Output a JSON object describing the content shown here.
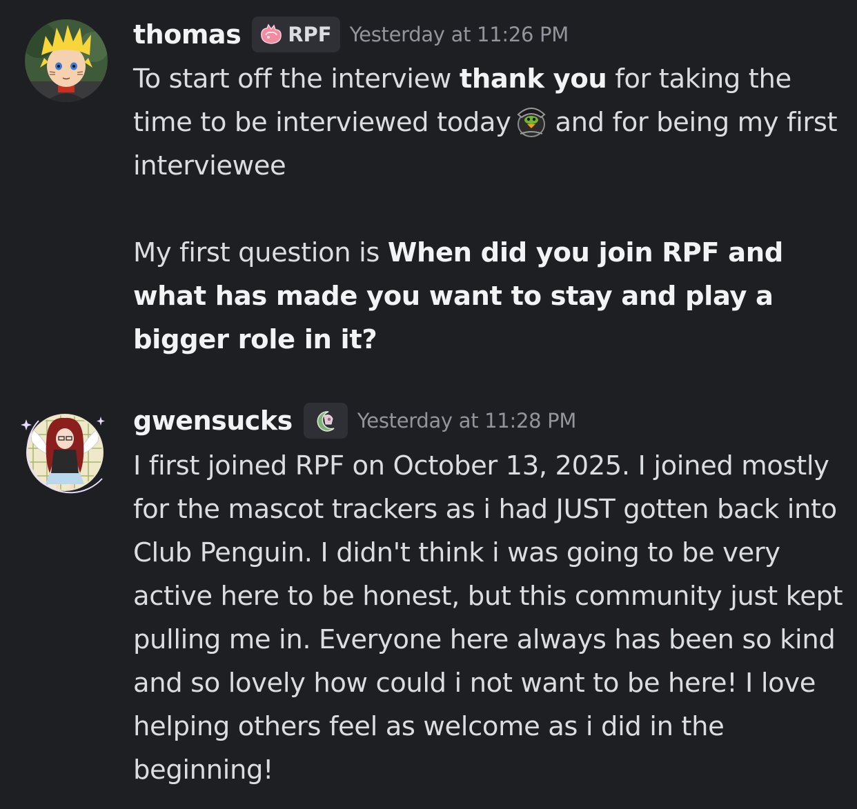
{
  "messages": [
    {
      "author": "thomas",
      "tag": "RPF",
      "timestamp": "Yesterday at 11:26 PM",
      "p1": {
        "t1": "To start off the interview ",
        "b1": "thank you",
        "t2": " for taking the time to be interviewed today",
        "t3": "and for being my first interviewee"
      },
      "p2": {
        "t1": "My first question is ",
        "b1": "When did you join RPF and what has made you want to stay and play a bigger role in it?"
      }
    },
    {
      "author": "gwensucks",
      "timestamp": "Yesterday at 11:28 PM",
      "text": "I first joined RPF on October 13, 2025. I joined mostly for the mascot trackers as i had JUST gotten back into Club Penguin. I didn't think i was going to be very active here to be honest, but this community just kept pulling me in. Everyone here always has been so kind and so lovely how could i not want to be here! I love helping others feel as welcome as i did in the beginning!"
    }
  ],
  "icons": {
    "avatar_1": "avatar-spiky-yellow-hair",
    "tag_icon_1": "pink-crystal-icon",
    "inline_emoji": "penguin-pirate-emoji",
    "avatar_2": "avatar-angel-moon",
    "tag_icon_2": "moon-badge-icon"
  },
  "colors": {
    "background": "#1e1f23",
    "text": "#dbdee1",
    "username": "#f2f3f5",
    "timestamp": "#93959c",
    "tag_bg": "#2e3036",
    "tag_icon_pink": "#f28aa0"
  }
}
